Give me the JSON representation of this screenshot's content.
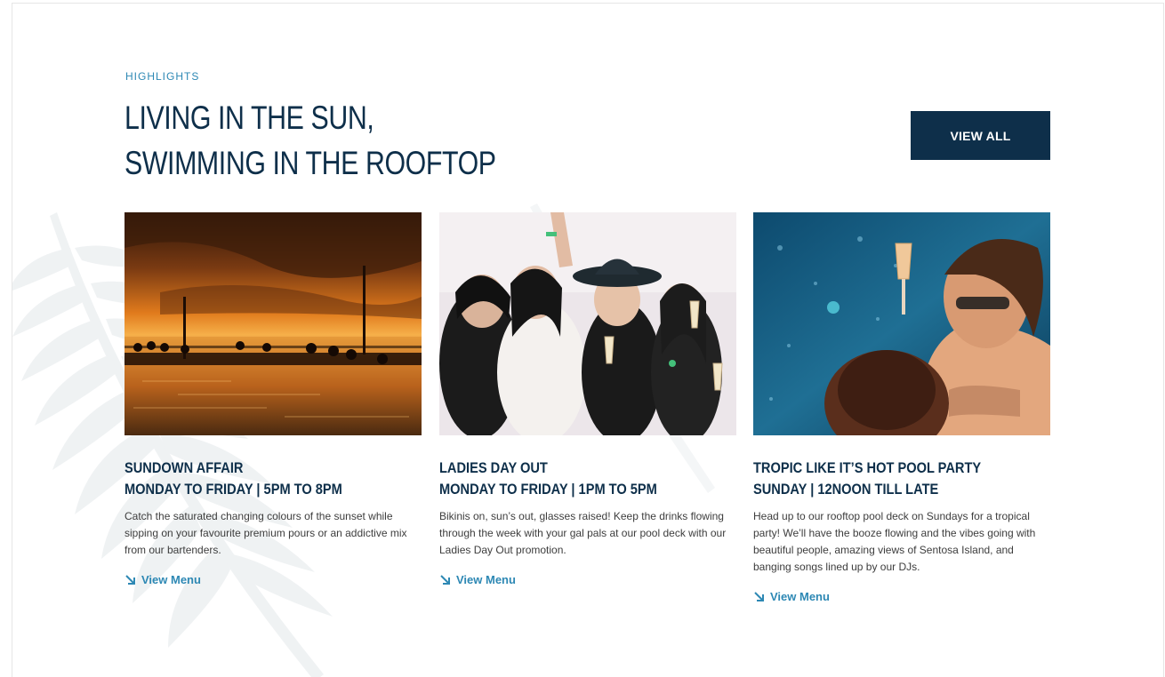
{
  "section": {
    "eyebrow": "HIGHLIGHTS",
    "headline_line1": "LIVING IN THE SUN,",
    "headline_line2": "SWIMMING IN THE ROOFTOP",
    "view_all_label": "VIEW ALL"
  },
  "cards": [
    {
      "title_line1": "SUNDOWN AFFAIR",
      "title_line2": "MONDAY TO FRIDAY | 5PM TO 8PM",
      "description": "Catch the saturated changing colours of the sunset while sipping on your favourite premium pours or an addictive mix from our bartenders.",
      "link_label": "View Menu"
    },
    {
      "title_line1": "LADIES DAY OUT",
      "title_line2": "MONDAY TO FRIDAY | 1PM TO 5PM",
      "description": "Bikinis on, sun’s out, glasses raised! Keep the drinks flowing through the week with your gal pals at our pool deck with our Ladies Day Out promotion.",
      "link_label": "View Menu"
    },
    {
      "title_line1": "TROPIC LIKE IT’S HOT POOL PARTY",
      "title_line2": "SUNDAY | 12NOON TILL LATE",
      "description": "Head up to our rooftop pool deck on Sundays for a tropical party! We’ll have the booze flowing and the vibes going with beautiful people, amazing views of Sentosa Island, and banging songs lined up by our DJs.",
      "link_label": "View Menu"
    }
  ],
  "colors": {
    "navy": "#0e2f4a",
    "accent": "#2d88b4",
    "body_text": "#3d3d3d"
  },
  "icons": {
    "link_icon": "arrow-down-right-icon",
    "background": "fern-leaf-icon"
  }
}
